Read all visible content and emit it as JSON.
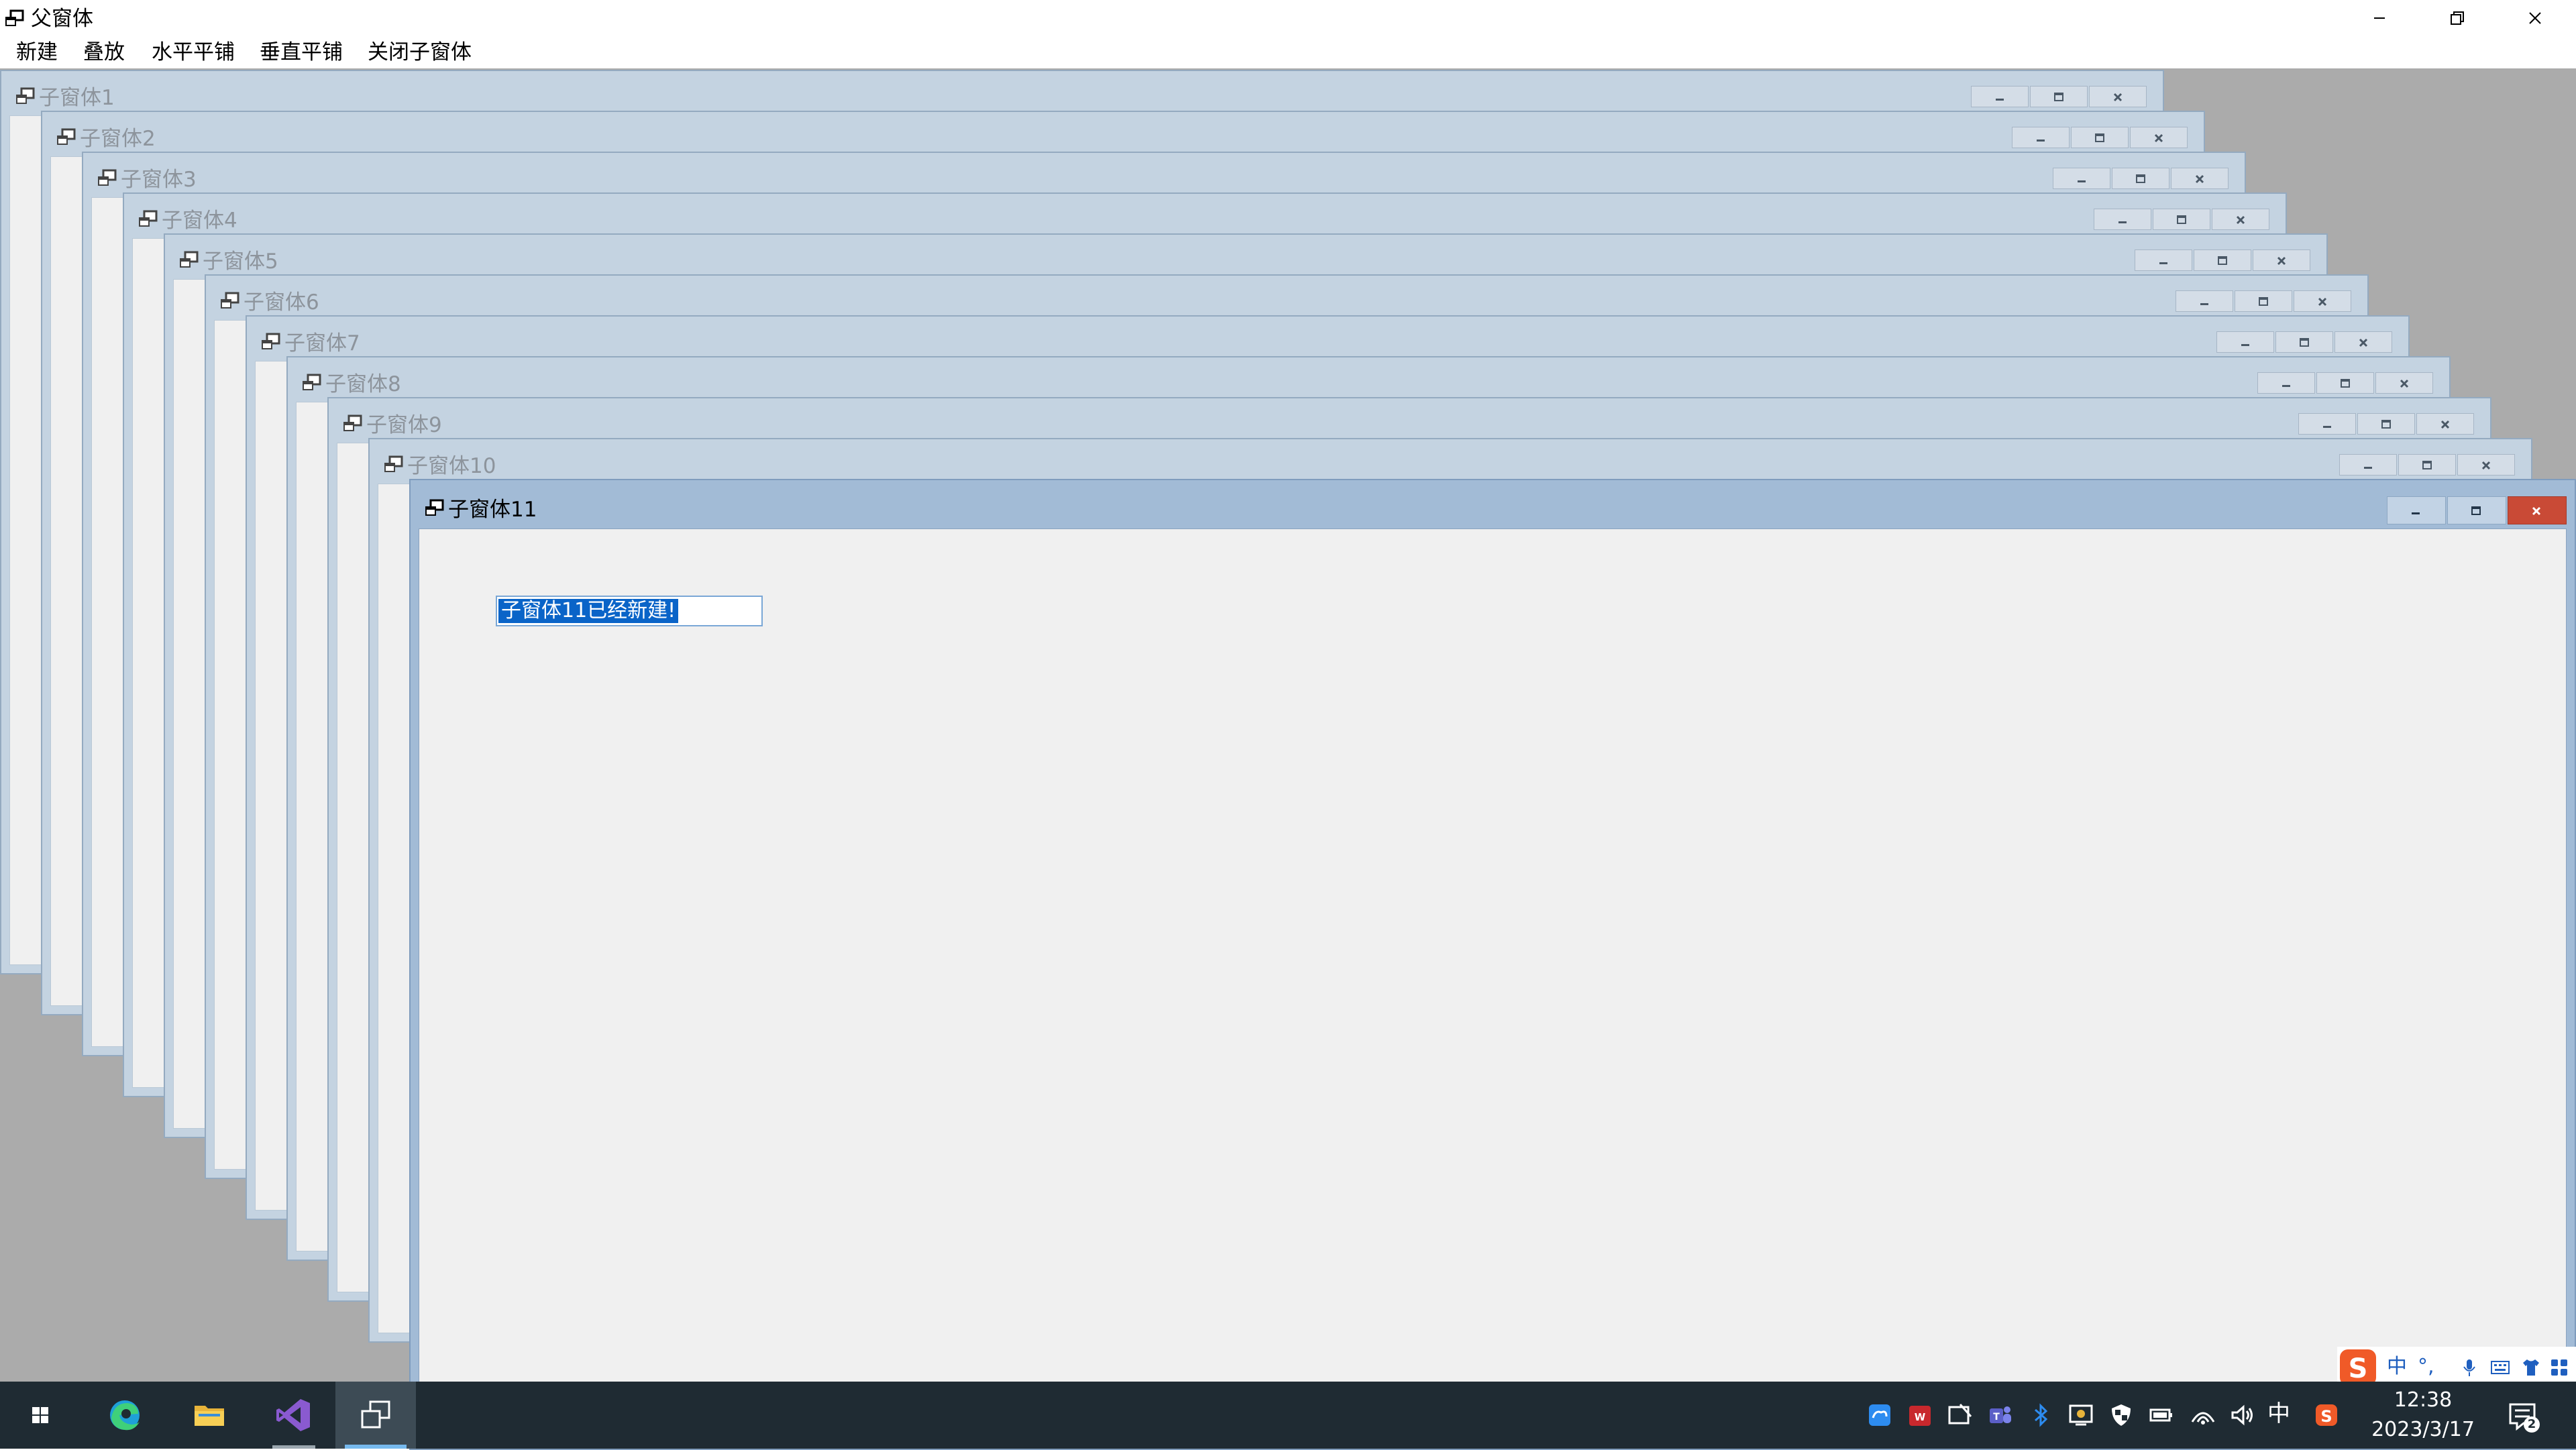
{
  "window": {
    "title": "父窗体"
  },
  "menu": {
    "items": [
      "新建",
      "叠放",
      "水平平铺",
      "垂直平铺",
      "关闭子窗体"
    ]
  },
  "children": [
    {
      "title": "子窗体1"
    },
    {
      "title": "子窗体2"
    },
    {
      "title": "子窗体3"
    },
    {
      "title": "子窗体4"
    },
    {
      "title": "子窗体5"
    },
    {
      "title": "子窗体6"
    },
    {
      "title": "子窗体7"
    },
    {
      "title": "子窗体8"
    },
    {
      "title": "子窗体9"
    },
    {
      "title": "子窗体10"
    }
  ],
  "active_child": {
    "title": "子窗体11",
    "textbox_value": "子窗体11已经新建!"
  },
  "ime": {
    "mode": "中",
    "punct": "°,"
  },
  "taskbar": {
    "items": [
      "start-icon",
      "edge-icon",
      "file-explorer-icon",
      "visual-studio-icon",
      "mdi-app-icon"
    ],
    "input_indicator": "中",
    "time": "12:38",
    "date": "2023/3/17",
    "notification_count": "2"
  },
  "colors": {
    "taskbar": "#1f2b33",
    "mdi_background": "#ababab",
    "child_frame": "#c4d3e1",
    "active_child_frame": "#a2bbd6",
    "close_red": "#c94a36",
    "selection": "#0a64c8"
  }
}
